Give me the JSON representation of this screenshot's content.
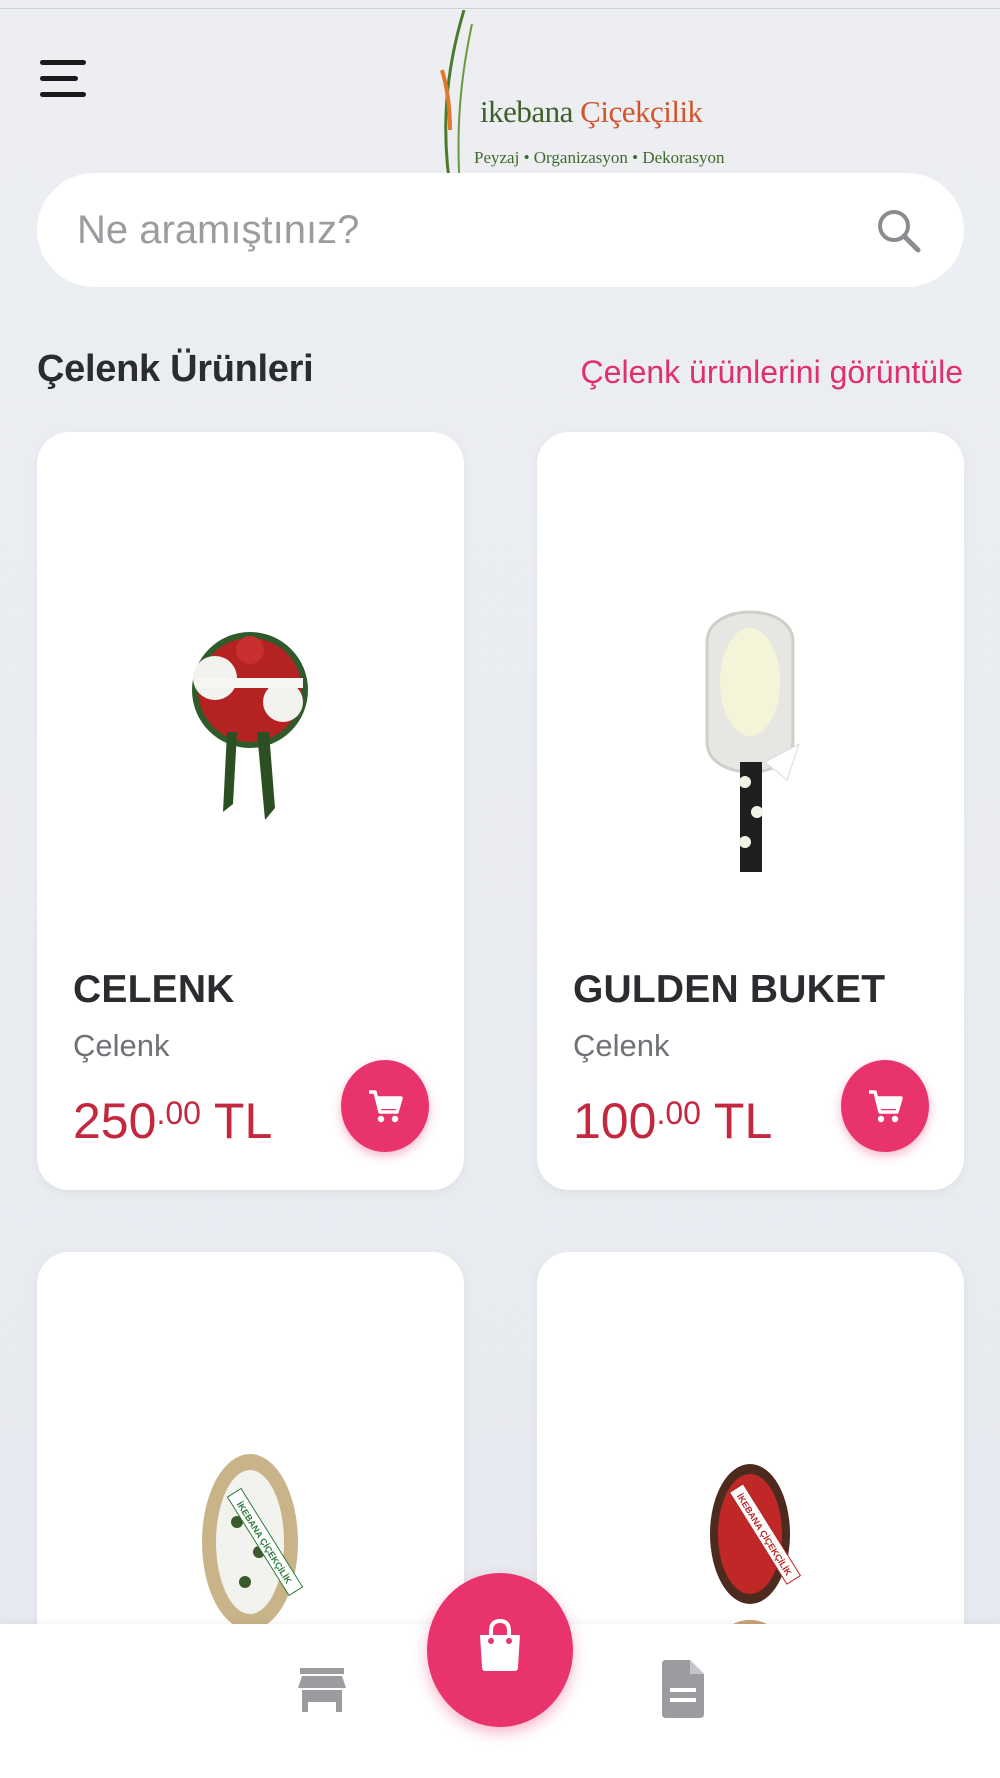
{
  "header": {
    "menu_icon": "hamburger-menu-icon",
    "logo": {
      "name_prefix": "ik",
      "name_main": "ebana",
      "name_suffix": "Çiçekçilik",
      "tagline": "Peyzaj • Organizasyon • Dekorasyon"
    }
  },
  "search": {
    "placeholder": "Ne aramıştınız?",
    "icon": "search-icon"
  },
  "section": {
    "title": "Çelenk Ürünleri",
    "link": "Çelenk ürünlerini görüntüle"
  },
  "products": [
    {
      "name": "CELENK",
      "category": "Çelenk",
      "price_int": "250",
      "price_dec": ".00",
      "currency": "TL"
    },
    {
      "name": "GULDEN BUKET",
      "category": "Çelenk",
      "price_int": "100",
      "price_dec": ".00",
      "currency": "TL"
    },
    {
      "name": "",
      "category": "",
      "price_int": "",
      "price_dec": "",
      "currency": "",
      "banner_text": "İKEBANA ÇİÇEKÇİLİK"
    },
    {
      "name": "",
      "category": "",
      "price_int": "",
      "price_dec": "",
      "currency": "",
      "banner_text": "İKEBANA ÇİÇEKÇİLİK"
    }
  ],
  "bottom_nav": {
    "items": [
      "store-icon",
      "shopping-bag-icon",
      "document-icon"
    ]
  },
  "colors": {
    "accent": "#e9336c",
    "price": "#c3283f",
    "link": "#e0306a",
    "background": "#eaecf0"
  }
}
